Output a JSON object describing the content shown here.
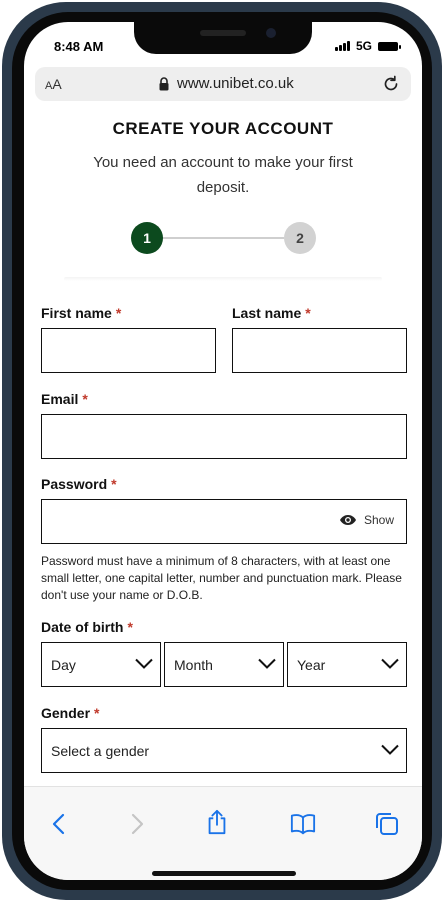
{
  "status": {
    "time": "8:48 AM",
    "network": "5G"
  },
  "browser": {
    "aa_small": "A",
    "aa_large": "A",
    "url": "www.unibet.co.uk"
  },
  "page": {
    "title": "CREATE YOUR ACCOUNT",
    "subtitle": "You need an account to make your first deposit.",
    "steps": [
      "1",
      "2"
    ]
  },
  "form": {
    "required_mark": "*",
    "first_name": {
      "label": "First name",
      "value": ""
    },
    "last_name": {
      "label": "Last name",
      "value": ""
    },
    "email": {
      "label": "Email",
      "value": ""
    },
    "password": {
      "label": "Password",
      "value": "",
      "show_label": "Show",
      "hint": "Password must have a minimum of 8 characters, with at least one small letter, one capital letter, number and punctuation mark. Please don't use your name or D.O.B."
    },
    "dob": {
      "label": "Date of birth",
      "day": "Day",
      "month": "Month",
      "year": "Year"
    },
    "gender": {
      "label": "Gender",
      "value": "Select a gender"
    }
  },
  "colors": {
    "step_active": "#0c4a1e",
    "required": "#c0392b",
    "cta": "#fdea72",
    "toolbar_icon": "#1a73e8"
  }
}
